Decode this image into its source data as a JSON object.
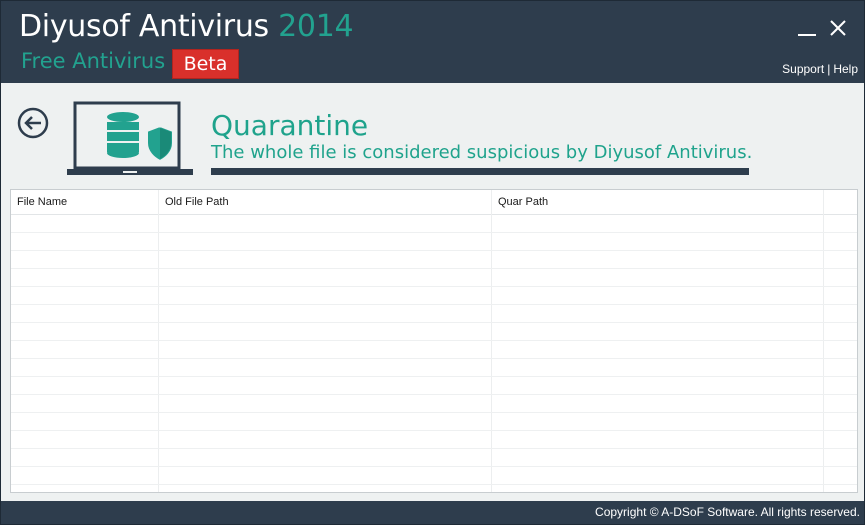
{
  "app": {
    "title_main": "Diyusof Antivirus",
    "title_year": "2014",
    "subtitle": "Free Antivirus",
    "badge": "Beta"
  },
  "window_controls": {
    "minimize_icon": "minimize-icon",
    "close_icon": "close-icon"
  },
  "links": {
    "support": "Support",
    "separator": "|",
    "help": "Help"
  },
  "header": {
    "title": "Quarantine",
    "description": "The whole file is considered suspicious by Diyusof Antivirus.",
    "icon": "laptop-database-shield-icon",
    "back_icon": "back-arrow-icon"
  },
  "table": {
    "columns": [
      "File Name",
      "Old File Path",
      "Quar Path",
      ""
    ],
    "rows": []
  },
  "footer": {
    "copyright": "Copyright © A-DSoF Software. All rights reserved."
  },
  "colors": {
    "dark": "#2e3d4d",
    "accent": "#22a28f",
    "badge": "#d9302b",
    "background": "#eef1f1"
  }
}
